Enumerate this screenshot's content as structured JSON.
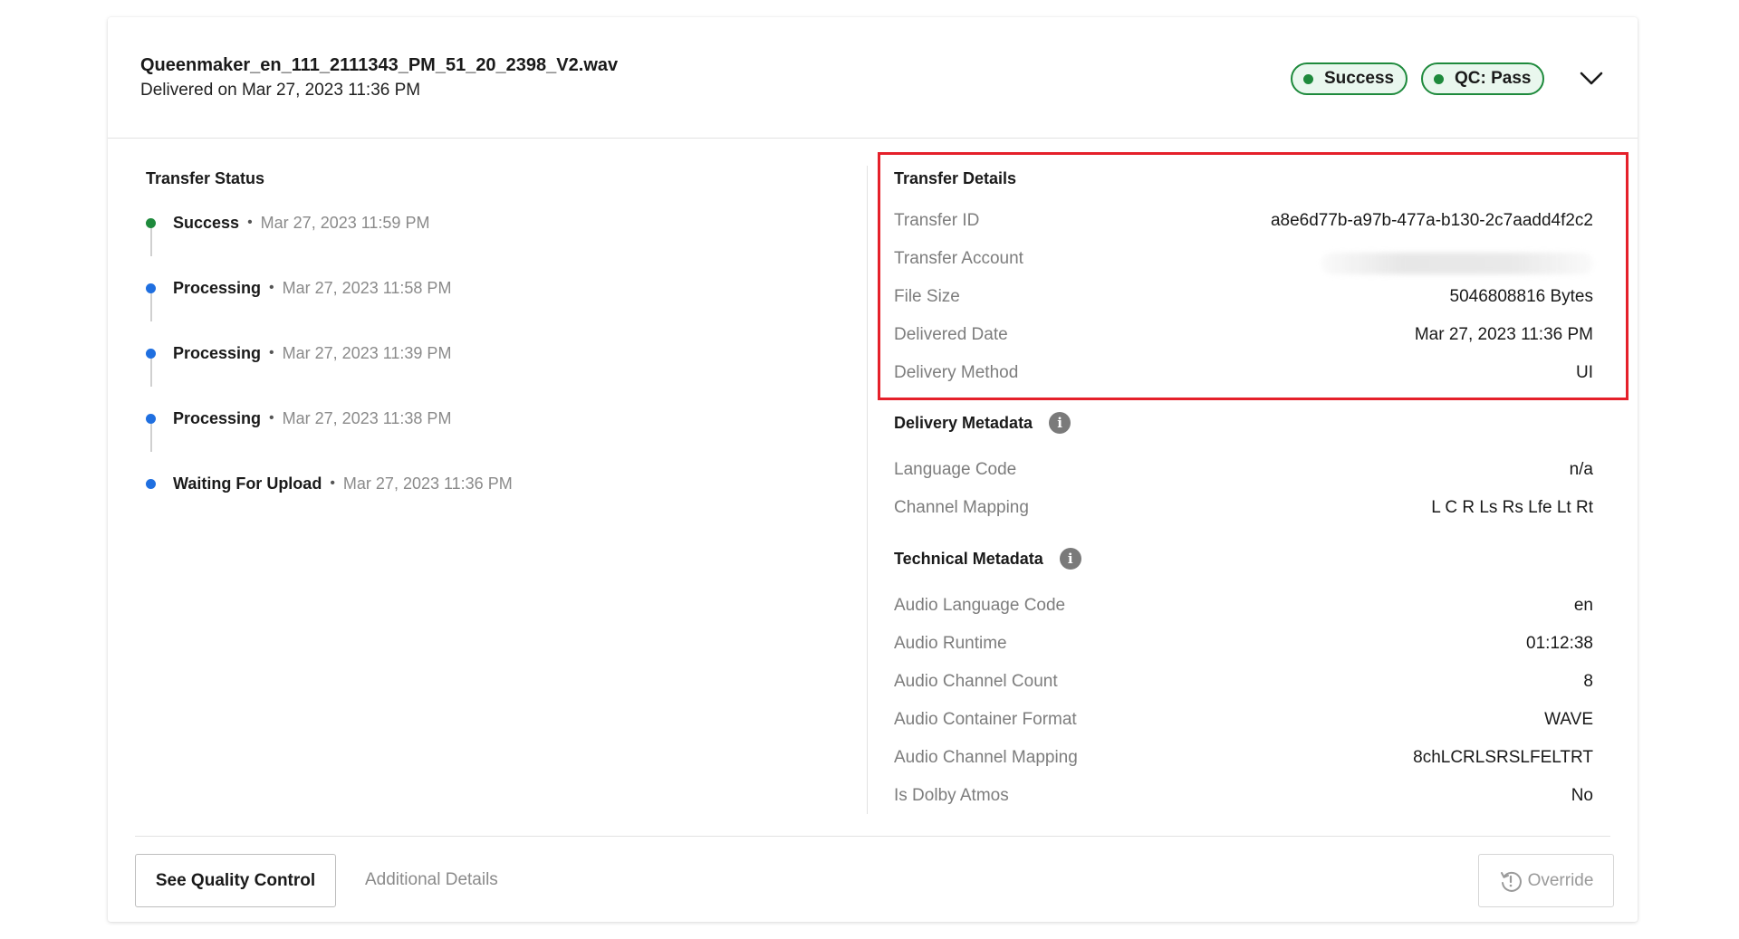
{
  "header": {
    "file_name": "Queenmaker_en_111_2111343_PM_51_20_2398_V2.wav",
    "delivered_on": "Delivered on Mar 27, 2023 11:36 PM",
    "badges": [
      {
        "label": "Success",
        "color": "#1e8a3c"
      },
      {
        "label": "QC: Pass",
        "color": "#1e8a3c"
      }
    ],
    "chevron_icon": "chevron-down-icon"
  },
  "transfer_status": {
    "title": "Transfer Status",
    "separator": "•",
    "items": [
      {
        "status": "Success",
        "time": "Mar 27, 2023 11:59 PM",
        "dot_color": "#1e8a3c"
      },
      {
        "status": "Processing",
        "time": "Mar 27, 2023 11:58 PM",
        "dot_color": "#1f6fe0"
      },
      {
        "status": "Processing",
        "time": "Mar 27, 2023 11:39 PM",
        "dot_color": "#1f6fe0"
      },
      {
        "status": "Processing",
        "time": "Mar 27, 2023 11:38 PM",
        "dot_color": "#1f6fe0"
      },
      {
        "status": "Waiting For Upload",
        "time": "Mar 27, 2023 11:36 PM",
        "dot_color": "#1f6fe0"
      }
    ]
  },
  "transfer_details": {
    "title": "Transfer Details",
    "rows": [
      {
        "label": "Transfer ID",
        "value": "a8e6d77b-a97b-477a-b130-2c7aadd4f2c2"
      },
      {
        "label": "Transfer Account",
        "value": ""
      },
      {
        "label": "File Size",
        "value": "5046808816 Bytes"
      },
      {
        "label": "Delivered Date",
        "value": "Mar 27, 2023 11:36 PM"
      },
      {
        "label": "Delivery Method",
        "value": "UI"
      }
    ]
  },
  "delivery_metadata": {
    "title": "Delivery Metadata",
    "info_icon": "i",
    "rows": [
      {
        "label": "Language Code",
        "value": "n/a"
      },
      {
        "label": "Channel Mapping",
        "value": "L C R Ls Rs Lfe Lt Rt"
      }
    ]
  },
  "technical_metadata": {
    "title": "Technical Metadata",
    "info_icon": "i",
    "rows": [
      {
        "label": "Audio Language Code",
        "value": "en"
      },
      {
        "label": "Audio Runtime",
        "value": "01:12:38"
      },
      {
        "label": "Audio Channel Count",
        "value": "8"
      },
      {
        "label": "Audio Container Format",
        "value": "WAVE"
      },
      {
        "label": "Audio Channel Mapping",
        "value": "8chLCRLSRSLFELTRT"
      },
      {
        "label": "Is Dolby Atmos",
        "value": "No"
      }
    ]
  },
  "footer": {
    "see_qc_label": "See Quality Control",
    "additional_label": "Additional Details",
    "override_label": "Override"
  },
  "colors": {
    "success_green": "#1e8a3c",
    "processing_blue": "#1f6fe0",
    "highlight_red": "#e5202a"
  }
}
